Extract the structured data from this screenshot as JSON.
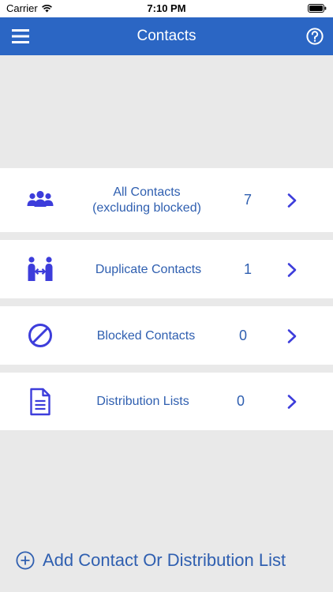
{
  "status_bar": {
    "carrier": "Carrier",
    "time": "7:10 PM"
  },
  "header": {
    "title": "Contacts",
    "menu_icon": "hamburger-menu-icon",
    "help_icon": "question-circle-icon"
  },
  "rows": [
    {
      "icon": "people-group-icon",
      "label": "All Contacts\n(excluding blocked)",
      "count": "7"
    },
    {
      "icon": "duplicate-people-icon",
      "label": "Duplicate Contacts",
      "count": "1"
    },
    {
      "icon": "blocked-circle-icon",
      "label": "Blocked Contacts",
      "count": "0"
    },
    {
      "icon": "document-list-icon",
      "label": "Distribution Lists",
      "count": "0"
    }
  ],
  "footer": {
    "add_label": "Add Contact Or Distribution List",
    "add_icon": "plus-circle-icon"
  },
  "colors": {
    "header_bg": "#2b66c4",
    "accent_text": "#2f5fb0",
    "icon_color": "#3d3ddb",
    "background": "#e9e9e9"
  }
}
